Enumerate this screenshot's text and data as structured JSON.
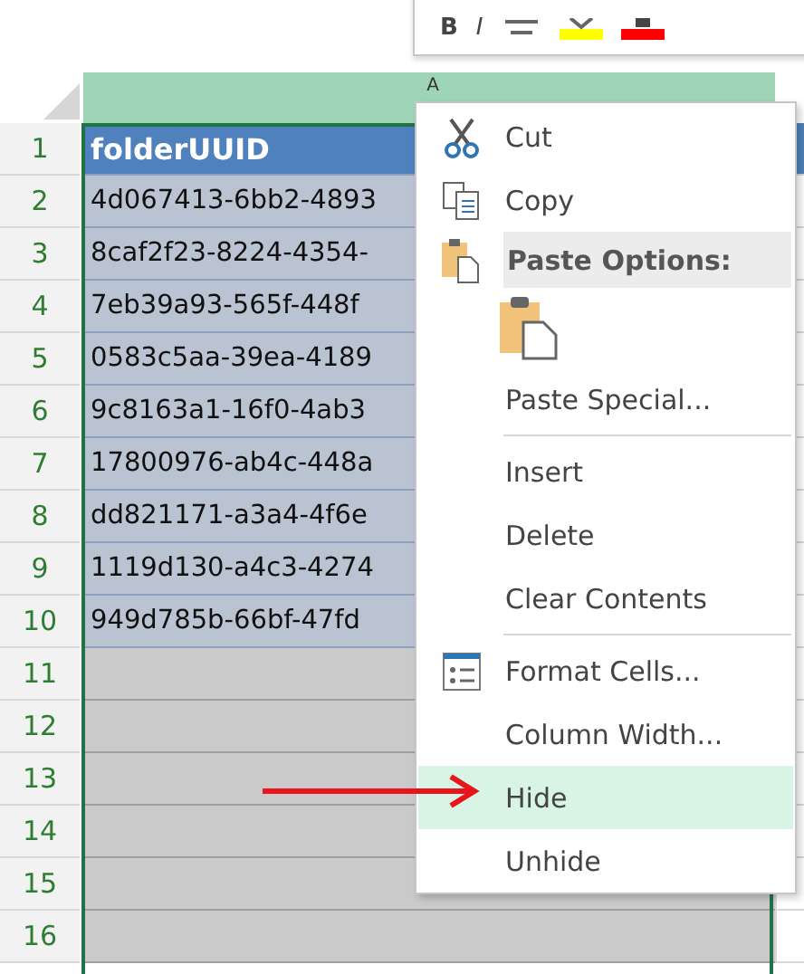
{
  "mini_toolbar": {
    "buttons": [
      {
        "kind": "bold",
        "label": "B"
      },
      {
        "kind": "italic",
        "label": "I"
      },
      {
        "kind": "align"
      },
      {
        "kind": "highlight"
      },
      {
        "kind": "font-color"
      }
    ]
  },
  "sheet": {
    "column_header": "A",
    "rows": [
      {
        "number": "1",
        "kind": "header",
        "cell": "folderUUID"
      },
      {
        "number": "2",
        "kind": "data",
        "cell": "4d067413-6bb2-4893"
      },
      {
        "number": "3",
        "kind": "data",
        "cell": "8caf2f23-8224-4354-"
      },
      {
        "number": "4",
        "kind": "data",
        "cell": "7eb39a93-565f-448f"
      },
      {
        "number": "5",
        "kind": "data",
        "cell": "0583c5aa-39ea-4189"
      },
      {
        "number": "6",
        "kind": "data",
        "cell": "9c8163a1-16f0-4ab3"
      },
      {
        "number": "7",
        "kind": "data",
        "cell": "17800976-ab4c-448a"
      },
      {
        "number": "8",
        "kind": "data",
        "cell": "dd821171-a3a4-4f6e"
      },
      {
        "number": "9",
        "kind": "data",
        "cell": "1119d130-a4c3-4274"
      },
      {
        "number": "10",
        "kind": "data",
        "cell": "949d785b-66bf-47fd"
      },
      {
        "number": "11",
        "kind": "empty"
      },
      {
        "number": "12",
        "kind": "empty"
      },
      {
        "number": "13",
        "kind": "empty"
      },
      {
        "number": "14",
        "kind": "empty"
      },
      {
        "number": "15",
        "kind": "empty"
      },
      {
        "number": "16",
        "kind": "empty"
      }
    ]
  },
  "context_menu": {
    "items": [
      {
        "kind": "cut",
        "label": "Cut",
        "selected": false
      },
      {
        "kind": "copy",
        "label": "Copy",
        "selected": false
      },
      {
        "kind": "header",
        "label": "Paste Options:"
      },
      {
        "kind": "paste-button"
      },
      {
        "kind": "command",
        "label": "Paste Special...",
        "selected": false
      },
      {
        "kind": "separator"
      },
      {
        "kind": "command",
        "label": "Insert",
        "selected": false
      },
      {
        "kind": "command",
        "label": "Delete",
        "selected": false
      },
      {
        "kind": "command",
        "label": "Clear Contents",
        "selected": false
      },
      {
        "kind": "separator"
      },
      {
        "kind": "format",
        "label": "Format Cells...",
        "selected": false
      },
      {
        "kind": "command",
        "label": "Column Width...",
        "selected": false
      },
      {
        "kind": "command",
        "label": "Hide",
        "selected": true
      },
      {
        "kind": "command",
        "label": "Unhide",
        "selected": false
      }
    ]
  },
  "annotation": {
    "kind": "arrow"
  }
}
